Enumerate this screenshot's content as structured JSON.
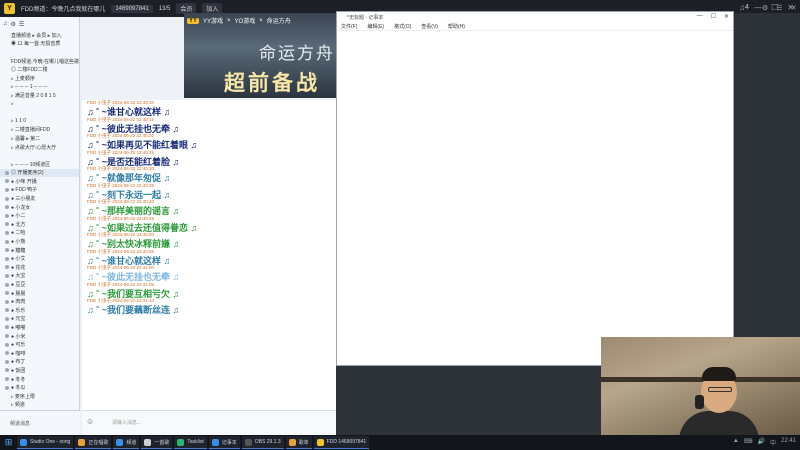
{
  "titlebar": {
    "logo_text": "Y",
    "title": "FDD频道：今晚几点我就在哪儿",
    "id_chip": "1469097841",
    "count": "13/5",
    "chip2": "会员",
    "chip3": "加入",
    "controls": [
      "♫",
      "—",
      "☐",
      "✕"
    ]
  },
  "sidebar": {
    "top_icons": [
      "♫",
      "⚙",
      "☰"
    ],
    "rows": [
      "直播频道 ▸ 会员 ▸ 加入",
      "◉ 11 每一首 无损音质",
      "",
      "FDD频道,今晚:在哪儿唱这些歌",
      "  ◎ 二楼FDD二楼",
      "  ▹ 上麦顺序",
      "  ▹ ─ ─ ─ 1 ─ ─ ─",
      "  ▹ 满足音量 2 0 8 1 5",
      "  ▹",
      "",
      "  ▹ 1 1 0",
      "  ▹ 二楼直播间FDD",
      "  ▹ 温馨 ▸ 第二",
      "  ▹ 点歌大厅:心愿大厅",
      "",
      "  ▹ ─ ─ ─ 10频道区",
      "◎ 开播麦序(2)",
      "  ● 小咪 开播",
      "  ● FDD 鸭子",
      "  ● 三小朋友",
      "  ● 小龙女",
      "  ● 小二",
      "  ● 北方 ",
      "  ● 二哈 ",
      "  ● 小熊 ",
      "  ● 糖糖",
      "  ● 小艾",
      "  ● 花花",
      "  ● 大宝",
      "  ● 豆豆",
      "  ● 晨晨",
      "  ● 肉肉",
      "  ● 乐乐",
      "  ● 元宝",
      "  ● 嘟嘟",
      "  ● 小米",
      "  ● 可乐",
      "  ● 咖啡",
      "  ● 布丁",
      "  ● 饭团",
      "  ● 冬冬",
      "  ● 冬瓜",
      "  ▹ 麦序上限",
      "  ▹ 频道",
      "  ▹ 麦序",
      "  ▹ 包厢",
      "  ▹ 包厢",
      "  ▹ 包厢"
    ],
    "footer": "频道消息"
  },
  "banner": {
    "yy_logo": "YY",
    "brand1": "YY游戏",
    "x1": "×",
    "brand2": "YO游戏",
    "x2": "×",
    "brand3": "命运方舟",
    "title1": "命运方舟",
    "title2": "超前备战"
  },
  "chat": {
    "messages": [
      {
        "meta": "FDD 小虫子 2024-06-22 22:40:10",
        "text": "♫ ˚ ~谁甘心就这样 ♫",
        "color": "#1a2c7a"
      },
      {
        "meta": "FDD 小虫子 2024-06-22 22:40:15",
        "text": "♫ ˚ ~彼此无挂也无牵 ♫",
        "color": "#1a2c7a"
      },
      {
        "meta": "FDD 小虫子 2024-06-22 22:40:20",
        "text": "♫ ˚ ~如果再见不能红着眼 ♫",
        "color": "#1a2c7a"
      },
      {
        "meta": "FDD 小虫子 2024-06-22 22:40:25",
        "text": "♫ ˚ ~是否还能红着脸 ♫",
        "color": "#1a2c7a"
      },
      {
        "meta": "FDD 小虫子 2024-06-22 22:40:30",
        "text": "♫ ˚ ~就像那年匆促 ♫",
        "color": "#2f7da6"
      },
      {
        "meta": "FDD 小虫子 2024-06-22 22:40:35",
        "text": "♫ ˚ ~刻下永远一起 ♫",
        "color": "#2f7da6"
      },
      {
        "meta": "FDD 小虫子 2024-06-22 22:40:40",
        "text": "♫ ˚ ~那样美丽的谣言 ♫",
        "color": "#2d9a3b"
      },
      {
        "meta": "FDD 小虫子 2024-06-22 22:40:45",
        "text": "♫ ˚ ~如果过去还值得眷恋 ♫",
        "color": "#2d9a3b"
      },
      {
        "meta": "FDD 小虫子 2024-06-22 22:40:50",
        "text": "♫ ˚ ~别太快冰释前嫌 ♫",
        "color": "#2d9a3b"
      },
      {
        "meta": "FDD 小虫子 2024-06-22 22:40:55",
        "text": "♫ ˚ ~谁甘心就这样 ♫",
        "color": "#2f7da6"
      },
      {
        "meta": "FDD 小虫子 2024-06-22 22:41:00",
        "text": "♫ ˚ ~彼此无挂也无牵 ♫",
        "color": "#7fb6e0"
      },
      {
        "meta": "FDD 小虫子 2024-06-22 22:41:05",
        "text": "♫ ˚ ~我们要互相亏欠 ♫",
        "color": "#2d9a3b"
      },
      {
        "meta": "FDD 小虫子 2024-06-22 22:41:10",
        "text": "♫ ˚ ~我们要藕断丝连 ♫",
        "color": "#2f7da6"
      }
    ],
    "input_placeholder": "请输入消息...",
    "input_icon": "☺"
  },
  "notepad": {
    "title": "*无标题 - 记事本",
    "controls": [
      "—",
      "☐",
      "✕"
    ],
    "menu": [
      "文件(F)",
      "编辑(E)",
      "格式(O)",
      "查看(V)",
      "帮助(H)"
    ]
  },
  "rightpane": {
    "label": "4",
    "icons": [
      "⚙",
      "☰",
      "✕"
    ]
  },
  "taskbar": {
    "start_icon": "⊞",
    "items": [
      {
        "label": "Studio One - song",
        "color": "#3a8ee6"
      },
      {
        "label": "正在唱歌",
        "color": "#e6a23a"
      },
      {
        "label": "频道",
        "color": "#3a8ee6"
      },
      {
        "label": "一首歌",
        "color": "#d0d0d0"
      },
      {
        "label": "Tasklist",
        "color": "#2bb673"
      },
      {
        "label": "记事本",
        "color": "#3a8ee6"
      },
      {
        "label": "OBS 29.1.3",
        "color": "#555"
      },
      {
        "label": "歌单",
        "color": "#e6a23a"
      },
      {
        "label": "FDD 1469097841",
        "color": "#f2c12e"
      }
    ],
    "tray": [
      "▲",
      "⌨",
      "🔊",
      "中",
      "22:41"
    ]
  }
}
